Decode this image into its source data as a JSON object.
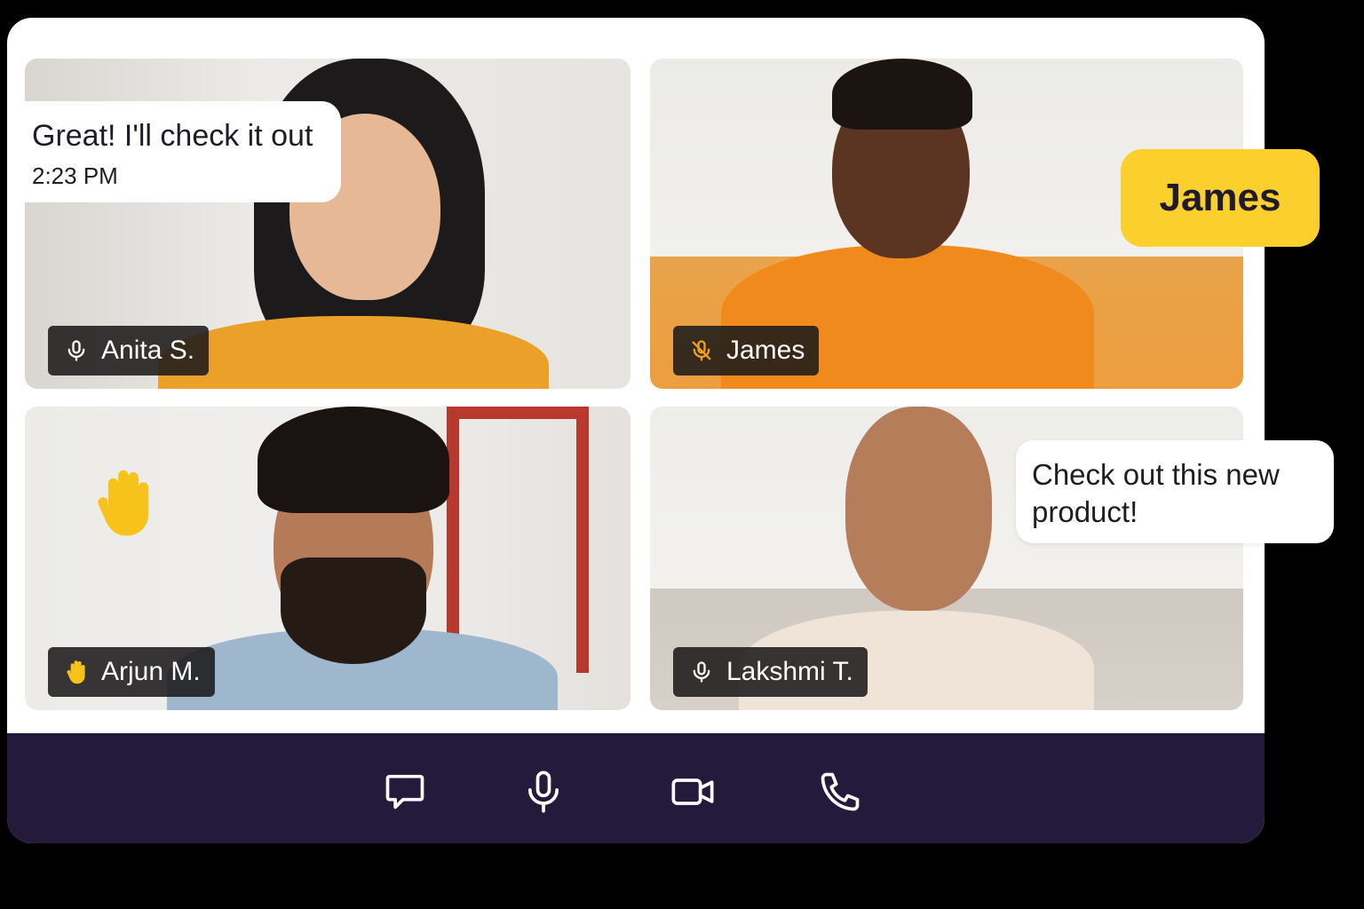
{
  "participants": [
    {
      "name": "Anita S.",
      "mic": "mic-on"
    },
    {
      "name": "James",
      "mic": "mic-muted"
    },
    {
      "name": "Arjun M.",
      "mic": "hand-raised"
    },
    {
      "name": "Lakshmi T.",
      "mic": "mic-on"
    }
  ],
  "chat_bubble_left": {
    "message": "Great! I'll check it out",
    "time": "2:23 PM"
  },
  "chat_bubble_right": {
    "message": "Check out this new product!"
  },
  "speaker_tag": {
    "label": "James"
  },
  "reaction": {
    "icon": "raised-hand-icon"
  },
  "controls": [
    {
      "icon": "chat-icon"
    },
    {
      "icon": "microphone-icon"
    },
    {
      "icon": "video-camera-icon"
    },
    {
      "icon": "phone-icon"
    }
  ],
  "colors": {
    "control_bar": "#231a3c",
    "speaker_tag": "#fcd02c",
    "muted_icon": "#f0a020",
    "hand_emoji": "#f7c21a"
  }
}
